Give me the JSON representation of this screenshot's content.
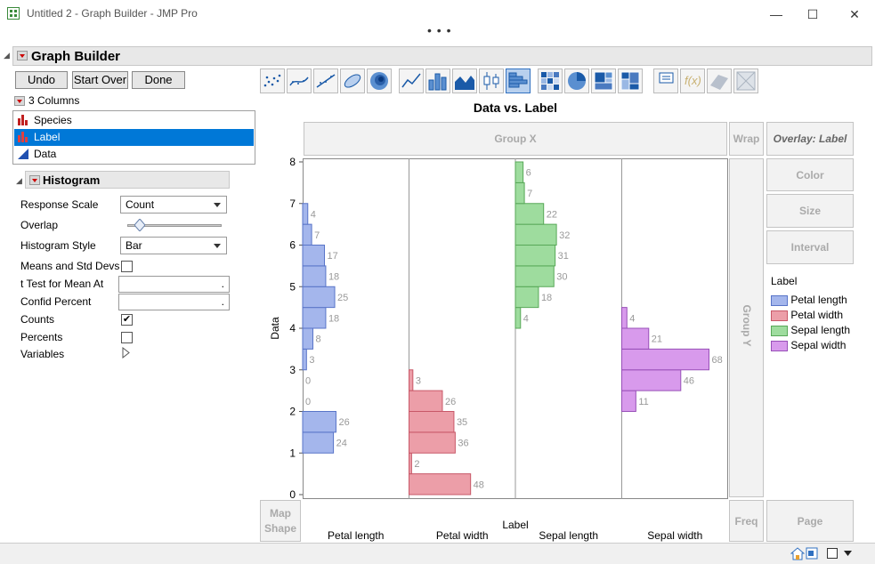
{
  "window": {
    "title": "Untitled 2 - Graph Builder - JMP Pro",
    "overflow": "• • •"
  },
  "platform": {
    "title": "Graph Builder",
    "buttons": {
      "undo": "Undo",
      "start_over": "Start Over",
      "done": "Done"
    }
  },
  "columns": {
    "header": "3 Columns",
    "items": [
      {
        "label": "Species",
        "icon": "nominal-bar-icon",
        "selected": false
      },
      {
        "label": "Label",
        "icon": "nominal-bar-icon",
        "selected": true
      },
      {
        "label": "Data",
        "icon": "continuous-triangle-icon",
        "selected": false
      }
    ]
  },
  "histogram": {
    "title": "Histogram",
    "response_scale_label": "Response Scale",
    "response_scale_value": "Count",
    "overlap_label": "Overlap",
    "overlap_value": 0.08,
    "style_label": "Histogram Style",
    "style_value": "Bar",
    "means_label": "Means and Std Devs",
    "means_checked": false,
    "ttest_label": "t Test for Mean At",
    "ttest_value": ".",
    "confid_label": "Confid Percent",
    "confid_value": ".",
    "counts_label": "Counts",
    "counts_checked": true,
    "percents_label": "Percents",
    "percents_checked": false,
    "variables_label": "Variables"
  },
  "toolbar": {
    "icons": [
      "points-icon",
      "smoother-icon",
      "line-of-fit-icon",
      "ellipse-icon",
      "contour-icon",
      "line-icon",
      "bar-icon",
      "area-icon",
      "box-plot-icon",
      "histogram-icon",
      "heatmap-icon",
      "pie-icon",
      "treemap-icon",
      "mosaic-icon",
      "caption-box-icon",
      "formula-icon",
      "parallel-icon",
      "map-shape-icon"
    ],
    "selected": "histogram-icon"
  },
  "zones": {
    "group_x": "Group X",
    "wrap": "Wrap",
    "overlay": "Overlay: Label",
    "color": "Color",
    "size": "Size",
    "interval": "Interval",
    "group_y": "Group Y",
    "map_shape": "Map Shape",
    "freq": "Freq",
    "page": "Page"
  },
  "legend": {
    "title": "Label",
    "items": [
      {
        "label": "Petal length",
        "fill": "#a4b6ec",
        "stroke": "#5874c8"
      },
      {
        "label": "Petal width",
        "fill": "#ec9ea8",
        "stroke": "#c85868"
      },
      {
        "label": "Sepal length",
        "fill": "#9edc9e",
        "stroke": "#58a858"
      },
      {
        "label": "Sepal width",
        "fill": "#d89aec",
        "stroke": "#9850b8"
      }
    ]
  },
  "chart_data": {
    "type": "bar",
    "title": "Data vs. Label",
    "xlabel": "Label",
    "ylabel": "Data",
    "ylim": [
      0,
      8
    ],
    "yticks": [
      "0",
      "1",
      "2",
      "3",
      "4",
      "5",
      "6",
      "7",
      "8"
    ],
    "bin_width": 0.5,
    "categories": [
      "Petal length",
      "Petal width",
      "Sepal length",
      "Sepal width"
    ],
    "series": [
      {
        "name": "Petal length",
        "bins": [
          {
            "lo": 1.0,
            "hi": 1.5,
            "count": 24
          },
          {
            "lo": 1.5,
            "hi": 2.0,
            "count": 26
          },
          {
            "lo": 2.0,
            "hi": 2.5,
            "count": 0
          },
          {
            "lo": 2.5,
            "hi": 3.0,
            "count": 0
          },
          {
            "lo": 3.0,
            "hi": 3.5,
            "count": 3
          },
          {
            "lo": 3.5,
            "hi": 4.0,
            "count": 8
          },
          {
            "lo": 4.0,
            "hi": 4.5,
            "count": 18
          },
          {
            "lo": 4.5,
            "hi": 5.0,
            "count": 25
          },
          {
            "lo": 5.0,
            "hi": 5.5,
            "count": 18
          },
          {
            "lo": 5.5,
            "hi": 6.0,
            "count": 17
          },
          {
            "lo": 6.0,
            "hi": 6.5,
            "count": 7
          },
          {
            "lo": 6.5,
            "hi": 7.0,
            "count": 4
          }
        ]
      },
      {
        "name": "Petal width",
        "bins": [
          {
            "lo": 0.0,
            "hi": 0.5,
            "count": 48
          },
          {
            "lo": 0.5,
            "hi": 1.0,
            "count": 2
          },
          {
            "lo": 1.0,
            "hi": 1.5,
            "count": 36
          },
          {
            "lo": 1.5,
            "hi": 2.0,
            "count": 35
          },
          {
            "lo": 2.0,
            "hi": 2.5,
            "count": 26
          },
          {
            "lo": 2.5,
            "hi": 3.0,
            "count": 3
          }
        ]
      },
      {
        "name": "Sepal length",
        "bins": [
          {
            "lo": 4.0,
            "hi": 4.5,
            "count": 4
          },
          {
            "lo": 4.5,
            "hi": 5.0,
            "count": 18
          },
          {
            "lo": 5.0,
            "hi": 5.5,
            "count": 30
          },
          {
            "lo": 5.5,
            "hi": 6.0,
            "count": 31
          },
          {
            "lo": 6.0,
            "hi": 6.5,
            "count": 32
          },
          {
            "lo": 6.5,
            "hi": 7.0,
            "count": 22
          },
          {
            "lo": 7.0,
            "hi": 7.5,
            "count": 7
          },
          {
            "lo": 7.5,
            "hi": 8.0,
            "count": 6
          }
        ]
      },
      {
        "name": "Sepal width",
        "bins": [
          {
            "lo": 2.0,
            "hi": 2.5,
            "count": 11
          },
          {
            "lo": 2.5,
            "hi": 3.0,
            "count": 46
          },
          {
            "lo": 3.0,
            "hi": 3.5,
            "count": 68
          },
          {
            "lo": 3.5,
            "hi": 4.0,
            "count": 21
          },
          {
            "lo": 4.0,
            "hi": 4.5,
            "count": 4
          }
        ]
      }
    ],
    "max_count": 68,
    "grid": false,
    "legend_position": "right"
  }
}
